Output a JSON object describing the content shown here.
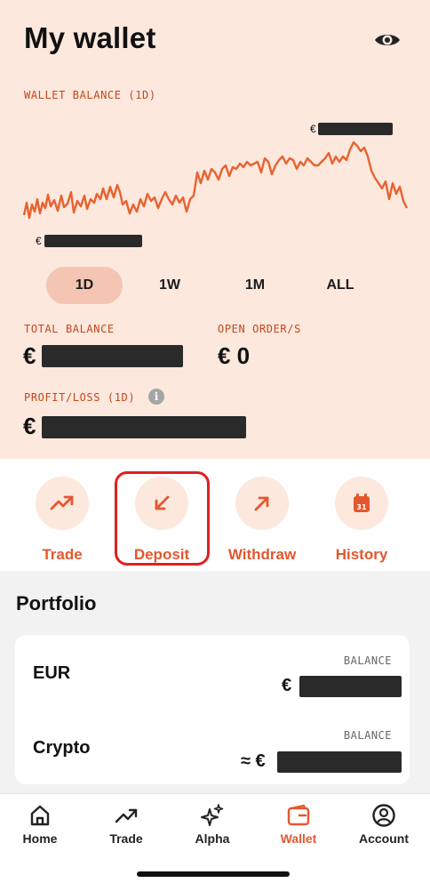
{
  "header": {
    "title": "My wallet",
    "visibility_icon": "eye-icon"
  },
  "wallet_chart": {
    "label": "WALLET BALANCE (1D)",
    "high_currency": "€",
    "low_currency": "€"
  },
  "ranges": [
    {
      "label": "1D",
      "active": true
    },
    {
      "label": "1W",
      "active": false
    },
    {
      "label": "1M",
      "active": false
    },
    {
      "label": "ALL",
      "active": false
    }
  ],
  "stats": {
    "total_balance_label": "TOTAL BALANCE",
    "total_balance_currency": "€",
    "open_orders_label": "OPEN ORDER/S",
    "open_orders_value": "€ 0",
    "profit_loss_label": "PROFIT/LOSS (1D)",
    "profit_loss_currency": "€",
    "info_glyph": "i"
  },
  "actions": [
    {
      "label": "Trade",
      "icon": "trend-up-icon"
    },
    {
      "label": "Deposit",
      "icon": "arrow-down-left-icon",
      "highlighted": true
    },
    {
      "label": "Withdraw",
      "icon": "arrow-up-right-icon"
    },
    {
      "label": "History",
      "icon": "calendar-icon",
      "icon_text": "31"
    }
  ],
  "portfolio": {
    "title": "Portfolio",
    "rows": [
      {
        "name": "EUR",
        "balance_label": "BALANCE",
        "currency": "€"
      },
      {
        "name": "Crypto",
        "balance_label": "BALANCE",
        "currency": "≈ €"
      }
    ]
  },
  "tabbar": [
    {
      "label": "Home",
      "icon": "home-icon",
      "active": false
    },
    {
      "label": "Trade",
      "icon": "trend-up-icon",
      "active": false
    },
    {
      "label": "Alpha",
      "icon": "sparkles-icon",
      "active": false
    },
    {
      "label": "Wallet",
      "icon": "wallet-icon",
      "active": true
    },
    {
      "label": "Account",
      "icon": "account-icon",
      "active": false
    }
  ],
  "colors": {
    "accent": "#e4572e",
    "hero_background": "#fde8de",
    "label_text": "#c2481b",
    "highlight_border": "#e02020"
  }
}
